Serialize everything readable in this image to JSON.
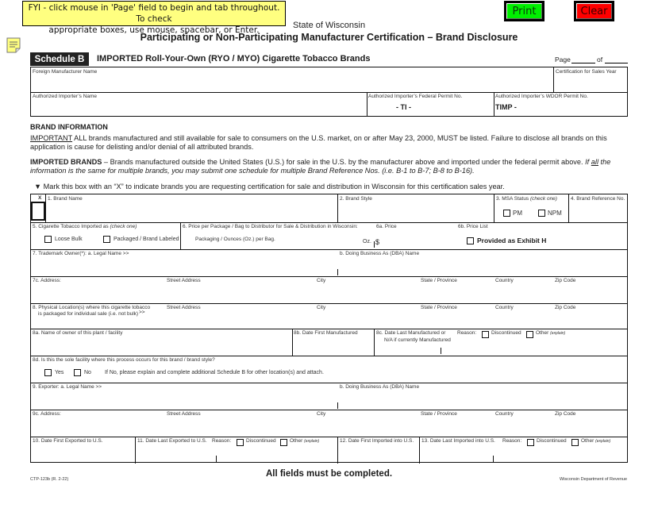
{
  "banner": {
    "fyi_line1": "FYI - click mouse in 'Page' field to begin and tab throughout. To check",
    "fyi_line2": "appropriate boxes, use mouse, spacebar, or Enter."
  },
  "buttons": {
    "print": "Print",
    "clear": "Clear"
  },
  "colors": {
    "banner": "#ffff80",
    "print": "#00f000",
    "clear": "#ff0000",
    "schedule_badge": "#222222"
  },
  "header": {
    "state": "State of Wisconsin",
    "title": "Participating or Non-Participating Manufacturer Certification – Brand Disclosure",
    "schedule": "Schedule B",
    "schedule_title": "IMPORTED Roll-Your-Own (RYO / MYO) Cigarette Tobacco Brands",
    "page_label": "Page",
    "of_label": "of",
    "page_value": "",
    "of_value": ""
  },
  "top_fields": {
    "foreign_manufacturer": "Foreign Manufacturer Name",
    "sales_year": "Certification for Sales Year",
    "importer_name": "Authorized Importer’s Name",
    "federal_permit": "Authorized Importer’s Federal Permit No.",
    "federal_permit_value": "- TI -",
    "wdor_permit": "Authorized Importer’s WDOR Permit No.",
    "wdor_permit_value": "TIMP -"
  },
  "brand_info": {
    "heading": "BRAND INFORMATION",
    "important_label": "IMPORTANT",
    "important_text": " ALL brands manufactured and still available for sale to consumers on the U.S. market, on or after May 23, 2000, MUST be listed. Failure to disclose all brands on this application is cause for delisting and/or denial of all attributed brands.",
    "imported_label": "IMPORTED BRANDS",
    "imported_text": " – Brands manufactured outside the United States (U.S.) for sale in the U.S. by the manufacturer above and imported under the federal permit above. ",
    "imported_italic_1": "If ",
    "imported_italic_u": "all",
    "imported_italic_2": " the information is the same for multiple brands, you may submit one schedule for multiple Brand Reference Nos. (i.e. B-1 to B-7; B-8 to B-16).",
    "mark_instruction": "▼ Mark this box with an “X” to indicate brands you are requesting certification for sale and distribution in Wisconsin for this certification sales year."
  },
  "form": {
    "x_label": "X",
    "brand_name": "1. Brand Name",
    "brand_style": "2. Brand Style",
    "msa_status": "3. MSA Status",
    "msa_check": "(check one)",
    "pm": "PM",
    "npm": "NPM",
    "brand_ref": "4. Brand Reference No.",
    "imported_as": "5. Cigarette Tobacco Imported as",
    "imported_as_check": "(check one)",
    "loose_bulk": "Loose Bulk",
    "packaged": "Packaged / Brand Labeled",
    "price": "6. Price per Package / Bag to Distributor for Sale & Distribution in Wisconsin:",
    "packaging": "Packaging / Ounces (Oz.) per Bag.",
    "oz": "Oz.",
    "price_6a": "6a. Price",
    "dollar": "$",
    "price_6b": "6b. Price List",
    "exhibit_h": "Provided as Exhibit H",
    "trademark_owner": "7. Trademark Owner(*):  a. Legal Name  >>",
    "dba": "b. Doing Business As (DBA) Name",
    "address_7c": "7c. Address:",
    "street": "Street Address",
    "city": "City",
    "state_prov": "State / Province",
    "country": "Country",
    "zip": "Zip Code",
    "physical_loc_1": "8. Physical Location(s) where this cigarette tobacco",
    "physical_loc_2": "is packaged for individual sale (i.e. not bulk)",
    "arrows": ">>",
    "owner_8a": "8a. Name of owner of this plant / facility",
    "date_8b": "8b. Date First Manufactured",
    "date_8c_1": "8c. Date Last Manufactured or",
    "date_8c_2": "N/A if currently Manufactured",
    "reason": "Reason:",
    "discontinued": "Discontinued",
    "other": "Other",
    "explain": "(explain)",
    "sole_8d": "8d. Is this the sole facility where this process occurs for this brand / brand style?",
    "yes": "Yes",
    "no": "No",
    "if_no": "If No, please explain and complete additional Schedule B for other location(s) and attach.",
    "exporter": "9. Exporter:  a. Legal Name  >>",
    "address_9c": "9c. Address:",
    "date_10": "10. Date First Exported to U.S.",
    "date_11": "11. Date Last Exported to U.S.",
    "date_12": "12. Date First Imported into U.S.",
    "date_13": "13. Date Last Imported into U.S."
  },
  "footer": {
    "code": "CTP-123b (R. 2-22)",
    "notice": "All fields must be completed.",
    "dept": "Wisconsin Department of Revenue"
  }
}
